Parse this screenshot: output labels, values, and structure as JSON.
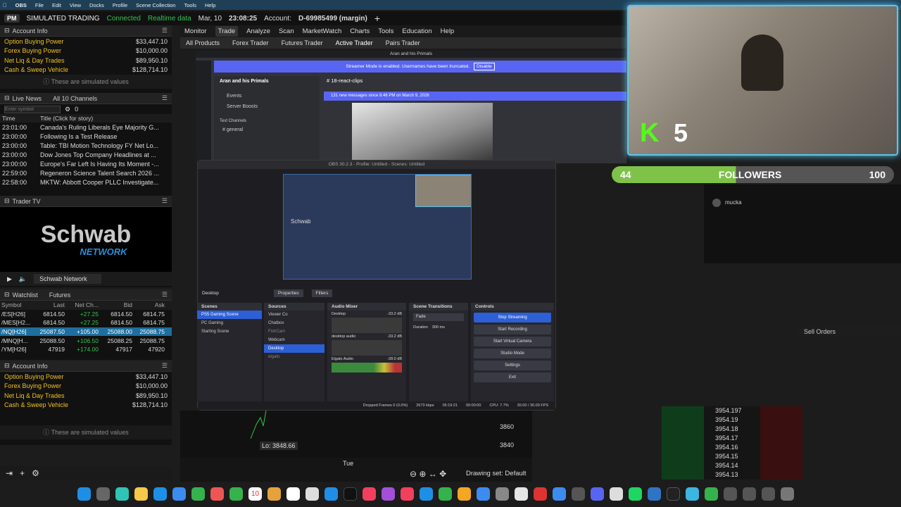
{
  "mac_menu": [
    "OBS",
    "File",
    "Edit",
    "View",
    "Docks",
    "Profile",
    "Scene Collection",
    "Tools",
    "Help"
  ],
  "top_bar": {
    "pm": "PM",
    "mode": "SIMULATED TRADING",
    "status": "Connected",
    "data": "Realtime data",
    "date": "Mar, 10",
    "time": "23:08:25",
    "account_label": "Account:",
    "account": "D-69985499 (margin)",
    "add": "+"
  },
  "account_info": {
    "title": "Account Info",
    "rows": [
      {
        "label": "Option Buying Power",
        "value": "$33,447.10"
      },
      {
        "label": "Forex Buying Power",
        "value": "$10,000.00"
      },
      {
        "label": "Net Liq & Day Trades",
        "value": "$89,950.10"
      },
      {
        "label": "Cash & Sweep Vehicle",
        "value": "$128,714.10"
      }
    ],
    "note": "These are simulated values"
  },
  "live_news": {
    "title": "Live News",
    "channels": "All 10 Channels",
    "symbol_placeholder": "Enter symbol",
    "count": "0",
    "col_time": "Time",
    "col_title": "Title (Click for story)",
    "items": [
      {
        "time": "23:01:00",
        "title": "Canada's Ruling Liberals Eye Majority G..."
      },
      {
        "time": "23:00:00",
        "title": "Following Is a Test Release"
      },
      {
        "time": "23:00:00",
        "title": "Table: TBI Motion Technology FY Net Lo..."
      },
      {
        "time": "23:00:00",
        "title": "Dow Jones Top Company Headlines at ..."
      },
      {
        "time": "23:00:00",
        "title": "Europe's Far Left Is Having Its Moment -..."
      },
      {
        "time": "22:59:00",
        "title": "Regeneron Science Talent Search 2026 ..."
      },
      {
        "time": "22:58:00",
        "title": "MKTW: Abbott Cooper PLLC Investigate..."
      }
    ]
  },
  "trader_tv": {
    "title": "Trader TV",
    "logo": "Schwab",
    "network": "NETWORK",
    "channel": "Schwab Network"
  },
  "watchlist": {
    "title": "Watchlist",
    "list": "Futures",
    "cols": [
      "Symbol",
      "Last",
      "Net Ch...",
      "Bid",
      "Ask"
    ],
    "rows": [
      {
        "sym": "/ES[H26]",
        "last": "6814.50",
        "chg": "+27.25",
        "bid": "6814.50",
        "ask": "6814.75"
      },
      {
        "sym": "/MES[H2...",
        "last": "6814.50",
        "chg": "+27.25",
        "bid": "6814.50",
        "ask": "6814.75"
      },
      {
        "sym": "/NQ[H26]",
        "last": "25087.50",
        "chg": "+105.00",
        "bid": "25088.00",
        "ask": "25088.75"
      },
      {
        "sym": "/MNQ[H...",
        "last": "25088.50",
        "chg": "+106.50",
        "bid": "25088.25",
        "ask": "25088.75"
      },
      {
        "sym": "/YM[H26]",
        "last": "47919",
        "chg": "+174.00",
        "bid": "47917",
        "ask": "47920"
      }
    ]
  },
  "account_info2": {
    "title": "Account Info",
    "rows": [
      {
        "label": "Option Buying Power",
        "value": "$33,447.10"
      },
      {
        "label": "Forex Buying Power",
        "value": "$10,000.00"
      },
      {
        "label": "Net Liq & Day Trades",
        "value": "$89,950.10"
      },
      {
        "label": "Cash & Sweep Vehicle",
        "value": "$128,714.10"
      }
    ],
    "note": "These are simulated values"
  },
  "nav": [
    "Monitor",
    "Trade",
    "Analyze",
    "Scan",
    "MarketWatch",
    "Charts",
    "Tools",
    "Education",
    "Help"
  ],
  "subnav": [
    "All Products",
    "Forex Trader",
    "Futures Trader",
    "Active Trader",
    "Pairs Trader"
  ],
  "discord": {
    "window_title": "Aran and his Primals",
    "streamer_banner": "Streamer Mode is enabled. Usernames have been truncated.",
    "disable": "Disable",
    "server": "Aran and his Primals",
    "channel": "18-react-clips",
    "new_messages": "131 new messages since 8:46 PM on March 9, 2026",
    "events": "Events",
    "boosts": "Server Boosts",
    "text_channels": "Text Channels",
    "general": "general"
  },
  "obs": {
    "title": "OBS 30.2.3 - Profile: Untitled - Scenes: Untitled",
    "source": "Desktop",
    "properties": "Properties",
    "filters": "Filters",
    "scenes_title": "Scenes",
    "scenes": [
      "PS5 Gaming Scene",
      "PC Gaming",
      "Starting Scene"
    ],
    "sources_title": "Sources",
    "sources": [
      "Viewer Co",
      "Chatbox",
      "FishCam",
      "Webcam",
      "Desktop",
      "elgato"
    ],
    "mixer_title": "Audio Mixer",
    "mixer": [
      {
        "name": "Desktop",
        "db": "-33.2 dB"
      },
      {
        "name": "desktop audio",
        "db": "-33.2 dB"
      },
      {
        "name": "Elgato Audio",
        "db": "-28.0 dB"
      }
    ],
    "transitions_title": "Scene Transitions",
    "transition": "Fade",
    "duration_label": "Duration",
    "duration": "300 ms",
    "controls_title": "Controls",
    "controls": [
      "Stop Streaming",
      "Start Recording",
      "Start Virtual Camera",
      "Studio Mode",
      "Settings",
      "Exit"
    ],
    "status": {
      "dropped": "Dropped Frames 0 (0.0%)",
      "kbps": "2673 kbps",
      "live": "05:19:21",
      "rec": "00:00:00",
      "cpu": "CPU: 7.7%",
      "fps": "30.00 / 30.00 FPS"
    },
    "preview_logo": "Schwab"
  },
  "cam_overlay": {
    "k": "K",
    "num": "5"
  },
  "followers": {
    "current": "44",
    "label": "FOLLOWERS",
    "goal": "100",
    "progress": 0.44
  },
  "chat": {
    "user": "mucka"
  },
  "right_panel": {
    "sell_orders": "Sell Orders",
    "prices": [
      "3954.197",
      "3954.19",
      "3954.18",
      "3954.17",
      "3954.16",
      "3954.15",
      "3954.14",
      "3954.13"
    ]
  },
  "chart": {
    "lo_label": "Lo: 3848.66",
    "y1": "3860",
    "y2": "3840",
    "x_label": "Tue",
    "drawing": "Drawing set: Default"
  },
  "dock_date": "10",
  "colors": {
    "accent": "#58c6f0",
    "positive": "#33c24d",
    "brand": "#1f3f57"
  }
}
